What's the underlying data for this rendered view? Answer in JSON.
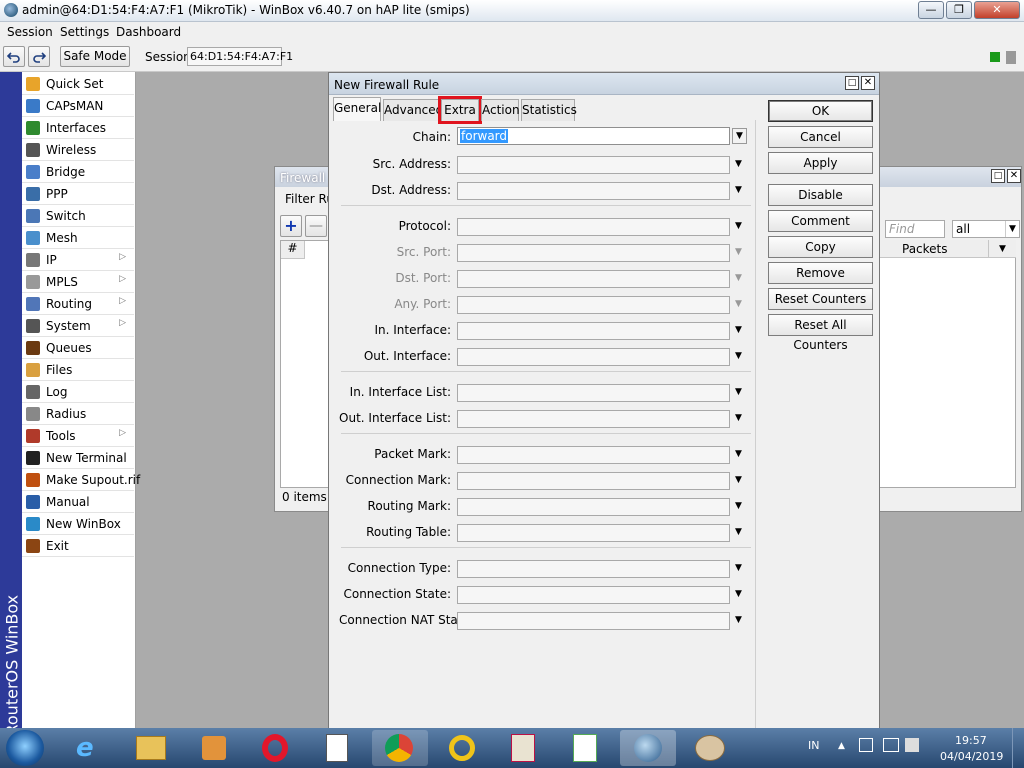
{
  "window": {
    "title": "admin@64:D1:54:F4:A7:F1 (MikroTik) - WinBox v6.40.7 on hAP lite (smips)"
  },
  "menu": [
    "Session",
    "Settings",
    "Dashboard"
  ],
  "toolbar": {
    "safe_mode": "Safe Mode",
    "session_label": "Session:",
    "session_value": "64:D1:54:F4:A7:F1"
  },
  "vertical_brand": "RouterOS WinBox",
  "sidebar": {
    "items": [
      {
        "label": "Quick Set",
        "icon": "quick-set-icon",
        "arrow": false
      },
      {
        "label": "CAPsMAN",
        "icon": "capsman-icon",
        "arrow": false
      },
      {
        "label": "Interfaces",
        "icon": "interfaces-icon",
        "arrow": false
      },
      {
        "label": "Wireless",
        "icon": "wireless-icon",
        "arrow": false
      },
      {
        "label": "Bridge",
        "icon": "bridge-icon",
        "arrow": false
      },
      {
        "label": "PPP",
        "icon": "ppp-icon",
        "arrow": false
      },
      {
        "label": "Switch",
        "icon": "switch-icon",
        "arrow": false
      },
      {
        "label": "Mesh",
        "icon": "mesh-icon",
        "arrow": false
      },
      {
        "label": "IP",
        "icon": "ip-icon",
        "arrow": true
      },
      {
        "label": "MPLS",
        "icon": "mpls-icon",
        "arrow": true
      },
      {
        "label": "Routing",
        "icon": "routing-icon",
        "arrow": true
      },
      {
        "label": "System",
        "icon": "system-icon",
        "arrow": true
      },
      {
        "label": "Queues",
        "icon": "queues-icon",
        "arrow": false
      },
      {
        "label": "Files",
        "icon": "files-icon",
        "arrow": false
      },
      {
        "label": "Log",
        "icon": "log-icon",
        "arrow": false
      },
      {
        "label": "Radius",
        "icon": "radius-icon",
        "arrow": false
      },
      {
        "label": "Tools",
        "icon": "tools-icon",
        "arrow": true
      },
      {
        "label": "New Terminal",
        "icon": "terminal-icon",
        "arrow": false
      },
      {
        "label": "Make Supout.rif",
        "icon": "supout-icon",
        "arrow": false
      },
      {
        "label": "Manual",
        "icon": "manual-icon",
        "arrow": false
      },
      {
        "label": "New WinBox",
        "icon": "winbox-icon",
        "arrow": false
      },
      {
        "label": "Exit",
        "icon": "exit-icon",
        "arrow": false
      }
    ]
  },
  "firewall": {
    "title": "Firewall",
    "tab": "Filter Rule",
    "find_placeholder": "Find",
    "filter_value": "all",
    "col_num": "#",
    "col_packets": "Packets",
    "status": "0 items"
  },
  "dialog": {
    "title": "New Firewall Rule",
    "tabs": [
      "General",
      "Advanced",
      "Extra",
      "Action",
      "Statistics"
    ],
    "highlighted_tab": "Extra",
    "chain_label": "Chain:",
    "chain_value": "forward",
    "fields": [
      "Src. Address:",
      "Dst. Address:",
      "Protocol:",
      "Src. Port:",
      "Dst. Port:",
      "Any. Port:",
      "In. Interface:",
      "Out. Interface:",
      "In. Interface List:",
      "Out. Interface List:",
      "Packet Mark:",
      "Connection Mark:",
      "Routing Mark:",
      "Routing Table:",
      "Connection Type:",
      "Connection State:",
      "Connection NAT State:"
    ],
    "buttons": [
      "OK",
      "Cancel",
      "Apply",
      "Disable",
      "Comment",
      "Copy",
      "Remove",
      "Reset Counters",
      "Reset All Counters"
    ]
  },
  "taskbar": {
    "lang": "IN",
    "time": "19:57",
    "date": "04/04/2019"
  },
  "colors": {
    "highlight_border": "#e0141e",
    "brand_strip": "#2d3a99",
    "selection": "#3399ff"
  }
}
